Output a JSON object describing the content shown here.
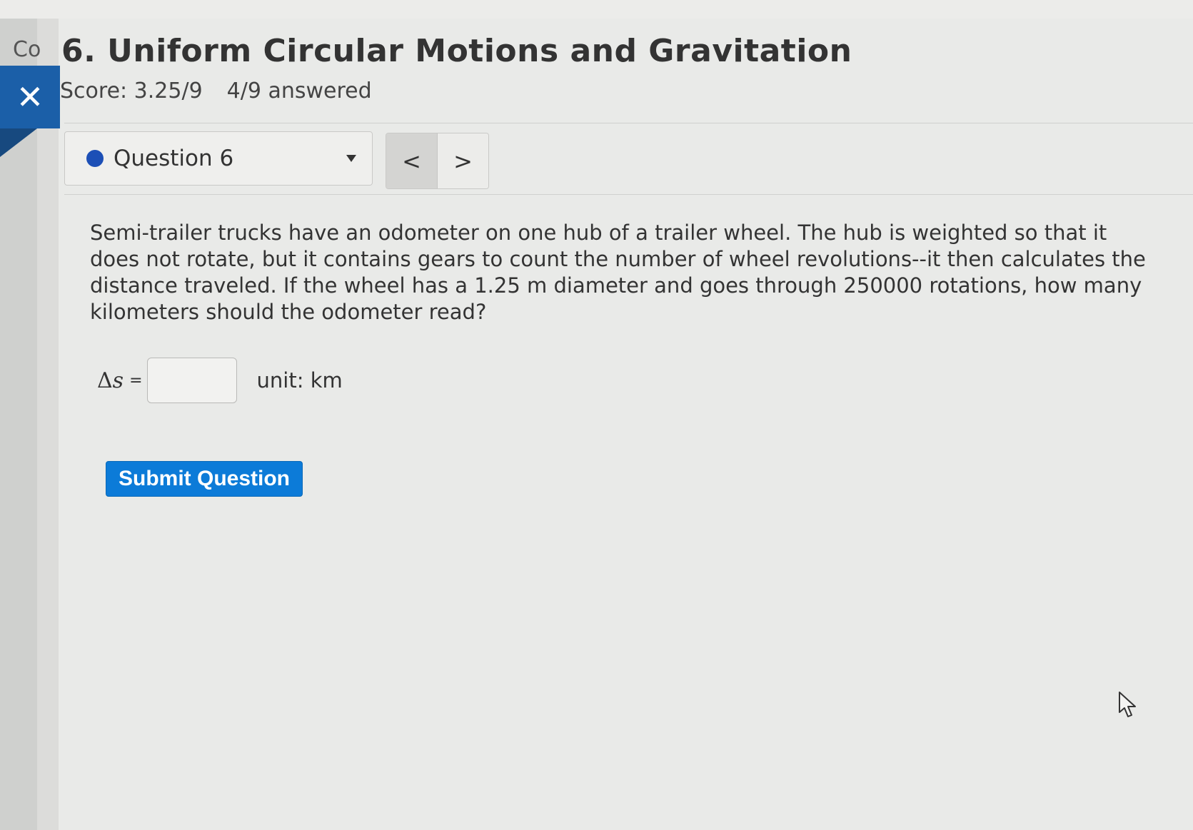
{
  "left_label": "Co",
  "close_button": {
    "icon": "close-icon",
    "glyph": "✕"
  },
  "page": {
    "title": "6. Uniform Circular Motions and Gravitation",
    "score": "Score: 3.25/9",
    "answered": "4/9 answered"
  },
  "question_select": {
    "label": "Question 6",
    "status_color": "#1c4fb6"
  },
  "nav": {
    "prev": "<",
    "next": ">"
  },
  "question": {
    "text": "Semi-trailer trucks have an odometer on one hub of a trailer wheel. The hub is weighted so that it does not rotate, but it contains gears to count the number of wheel revolutions--it then calculates the distance traveled. If the wheel has a 1.25 m diameter and goes through 250000 rotations, how many kilometers should the odometer read?"
  },
  "answer": {
    "delta_symbol": "Δ",
    "variable": "s",
    "equals": "=",
    "value": "",
    "unit": "unit: km"
  },
  "submit": {
    "label": "Submit Question",
    "color": "#0c7bd8"
  }
}
